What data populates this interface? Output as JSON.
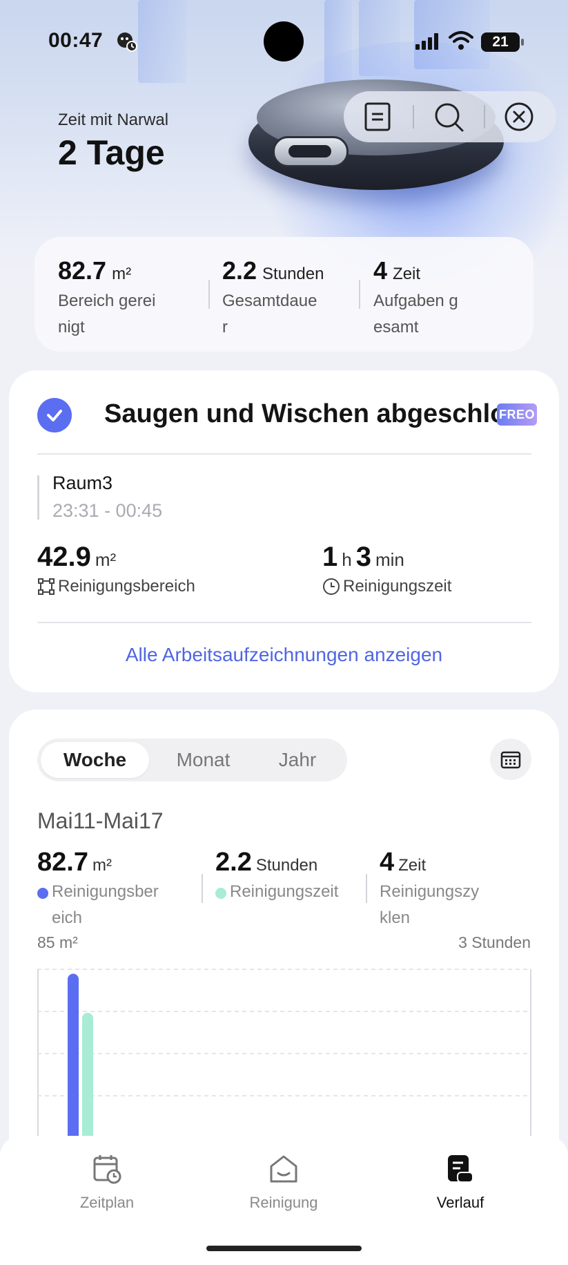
{
  "status_bar": {
    "time": "00:47",
    "battery": "21"
  },
  "hero": {
    "subtitle": "Zeit mit Narwal",
    "title": "2 Tage"
  },
  "toolbar": {
    "icons": [
      "document-icon",
      "search-icon",
      "close-icon"
    ]
  },
  "summary": [
    {
      "value": "82.7",
      "unit": "m²",
      "label": "Bereich gereinigt"
    },
    {
      "value": "2.2",
      "unit": "Stunden",
      "label": "Gesamtdauer"
    },
    {
      "value": "4",
      "unit": "Zeit",
      "label": "Aufgaben gesamt"
    }
  ],
  "task": {
    "title": "Saugen und Wischen abgeschlossen",
    "badge": "FREO",
    "room": "Raum3",
    "time_range": "23:31 - 00:45",
    "area_value": "42.9",
    "area_unit": "m²",
    "area_label": "Reinigungsbereich",
    "duration_h": "1",
    "duration_h_unit": "h",
    "duration_min": "3",
    "duration_min_unit": "min",
    "duration_label": "Reinigungszeit",
    "link": "Alle Arbeitsaufzeichnungen anzeigen"
  },
  "stats": {
    "tabs": [
      {
        "label": "Woche",
        "active": true
      },
      {
        "label": "Monat",
        "active": false
      },
      {
        "label": "Jahr",
        "active": false
      }
    ],
    "range": "Mai11-Mai17",
    "items": [
      {
        "value": "82.7",
        "unit": "m²",
        "label": "Reinigungsbereich"
      },
      {
        "value": "2.2",
        "unit": "Stunden",
        "label": "Reinigungszeit"
      },
      {
        "value": "4",
        "unit": "Zeit",
        "label": "Reinigungszyklen"
      }
    ],
    "axis_left": "85 m²",
    "axis_right": "3 Stunden",
    "colors": {
      "area": "#5b6df0",
      "time": "#a8ecd5"
    }
  },
  "chart_data": {
    "type": "bar",
    "series": [
      {
        "name": "Reinigungsbereich",
        "values": [
          82.7,
          0,
          0,
          0,
          0,
          0,
          0
        ]
      },
      {
        "name": "Reinigungszeit",
        "values": [
          2.2,
          0,
          0,
          0,
          0,
          0,
          0
        ]
      }
    ],
    "ylim_left": [
      0,
      85
    ],
    "ylim_right": [
      0,
      3
    ],
    "grid": true
  },
  "nav": [
    {
      "label": "Zeitplan",
      "icon": "calendar-clock-icon",
      "active": false
    },
    {
      "label": "Reinigung",
      "icon": "home-icon",
      "active": false
    },
    {
      "label": "Verlauf",
      "icon": "history-icon",
      "active": true
    }
  ]
}
